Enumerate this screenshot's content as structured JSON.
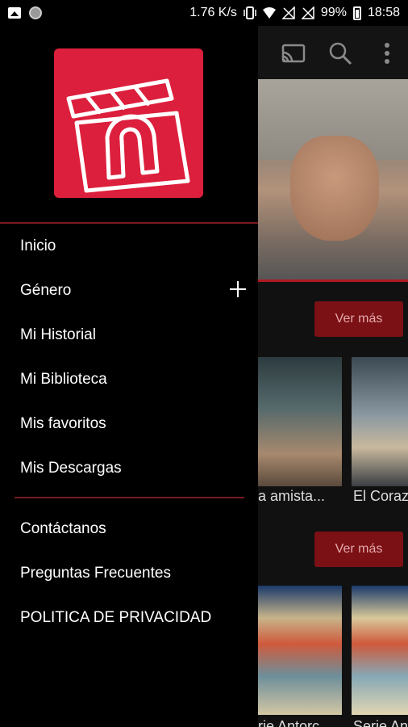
{
  "status_bar": {
    "speed": "1.76 K/s",
    "battery": "99%",
    "time": "18:58",
    "icons": [
      "image-icon",
      "sync-dot-icon",
      "vibrate-icon",
      "wifi-icon",
      "no-signal-icon",
      "no-signal-icon",
      "battery-icon"
    ]
  },
  "toolbar": {
    "icons": [
      "cast-icon",
      "search-icon",
      "more-vert-icon"
    ]
  },
  "drawer": {
    "menu_primary": [
      {
        "label": "Inicio"
      },
      {
        "label": "Género",
        "expand_icon": "plus-icon"
      },
      {
        "label": "Mi Historial"
      },
      {
        "label": "Mi Biblioteca"
      },
      {
        "label": "Mis favoritos"
      },
      {
        "label": "Mis Descargas"
      }
    ],
    "menu_secondary": [
      {
        "label": "Contáctanos"
      },
      {
        "label": "Preguntas Frecuentes"
      },
      {
        "label": "POLITICA DE PRIVACIDAD"
      }
    ]
  },
  "content": {
    "more_label_1": "Ver más",
    "more_label_2": "Ver más",
    "row1_titles": [
      "a amista...",
      "El Coraz"
    ],
    "row2_titles": [
      "rie Antorc",
      "Serie An"
    ]
  },
  "colors": {
    "accent": "#dc1f3c",
    "divider": "#7a1a1f",
    "button_bg": "#7b1015"
  }
}
